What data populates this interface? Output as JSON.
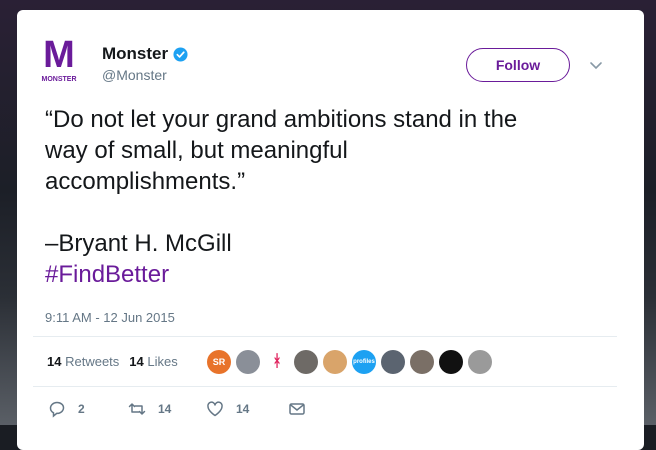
{
  "account": {
    "display_name": "Monster",
    "handle": "@Monster",
    "logo_letter": "M",
    "logo_word": "MONSTER",
    "brand_color": "#6a1b9a"
  },
  "follow_label": "Follow",
  "tweet": {
    "lines": [
      "“Do not let your grand ambitions stand in the",
      "way of small, but meaningful",
      "accomplishments.”",
      "–Bryant H. McGill"
    ],
    "hashtag": "#FindBetter",
    "timestamp": "9:11 AM - 12 Jun 2015"
  },
  "stats": {
    "retweets_count": "14",
    "retweets_label": "Retweets",
    "likes_count": "14",
    "likes_label": "Likes"
  },
  "likers": [
    {
      "text": "SR",
      "color": "#e8732a"
    },
    {
      "text": "",
      "color": "#8a8f98"
    },
    {
      "text": "ᚼ",
      "color": "#ffffff"
    },
    {
      "text": "",
      "color": "#6e6a66"
    },
    {
      "text": "",
      "color": "#d9a46a"
    },
    {
      "text": "profiles",
      "color": "#1da1f2"
    },
    {
      "text": "",
      "color": "#5b6470"
    },
    {
      "text": "",
      "color": "#7a6f66"
    },
    {
      "text": "",
      "color": "#111111"
    },
    {
      "text": "",
      "color": "#9a9a9a"
    }
  ],
  "actions": {
    "reply_count": "2",
    "retweet_count": "14",
    "like_count": "14"
  }
}
